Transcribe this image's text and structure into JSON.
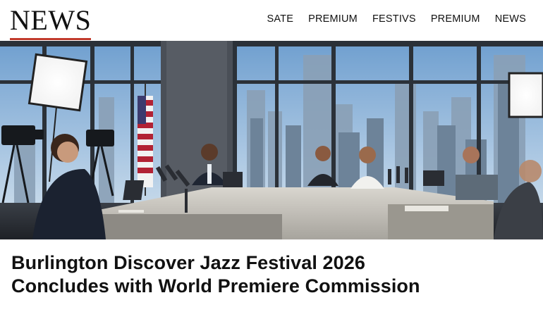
{
  "header": {
    "logo_text": "NEWS",
    "nav_items": [
      {
        "label": "SATE"
      },
      {
        "label": "PREMIUM"
      },
      {
        "label": "FESTIVS"
      },
      {
        "label": "PREMIUM"
      },
      {
        "label": "NEWS"
      }
    ]
  },
  "hero": {
    "image_alt": "Press conference panel in a high-rise room with city skyline windows"
  },
  "article": {
    "headline_line1": "Burlington Discover Jazz Festival 2026",
    "headline_line2": "Concludes with World Premiere Commission"
  },
  "colors": {
    "accent": "#c0392b",
    "text": "#111111"
  }
}
